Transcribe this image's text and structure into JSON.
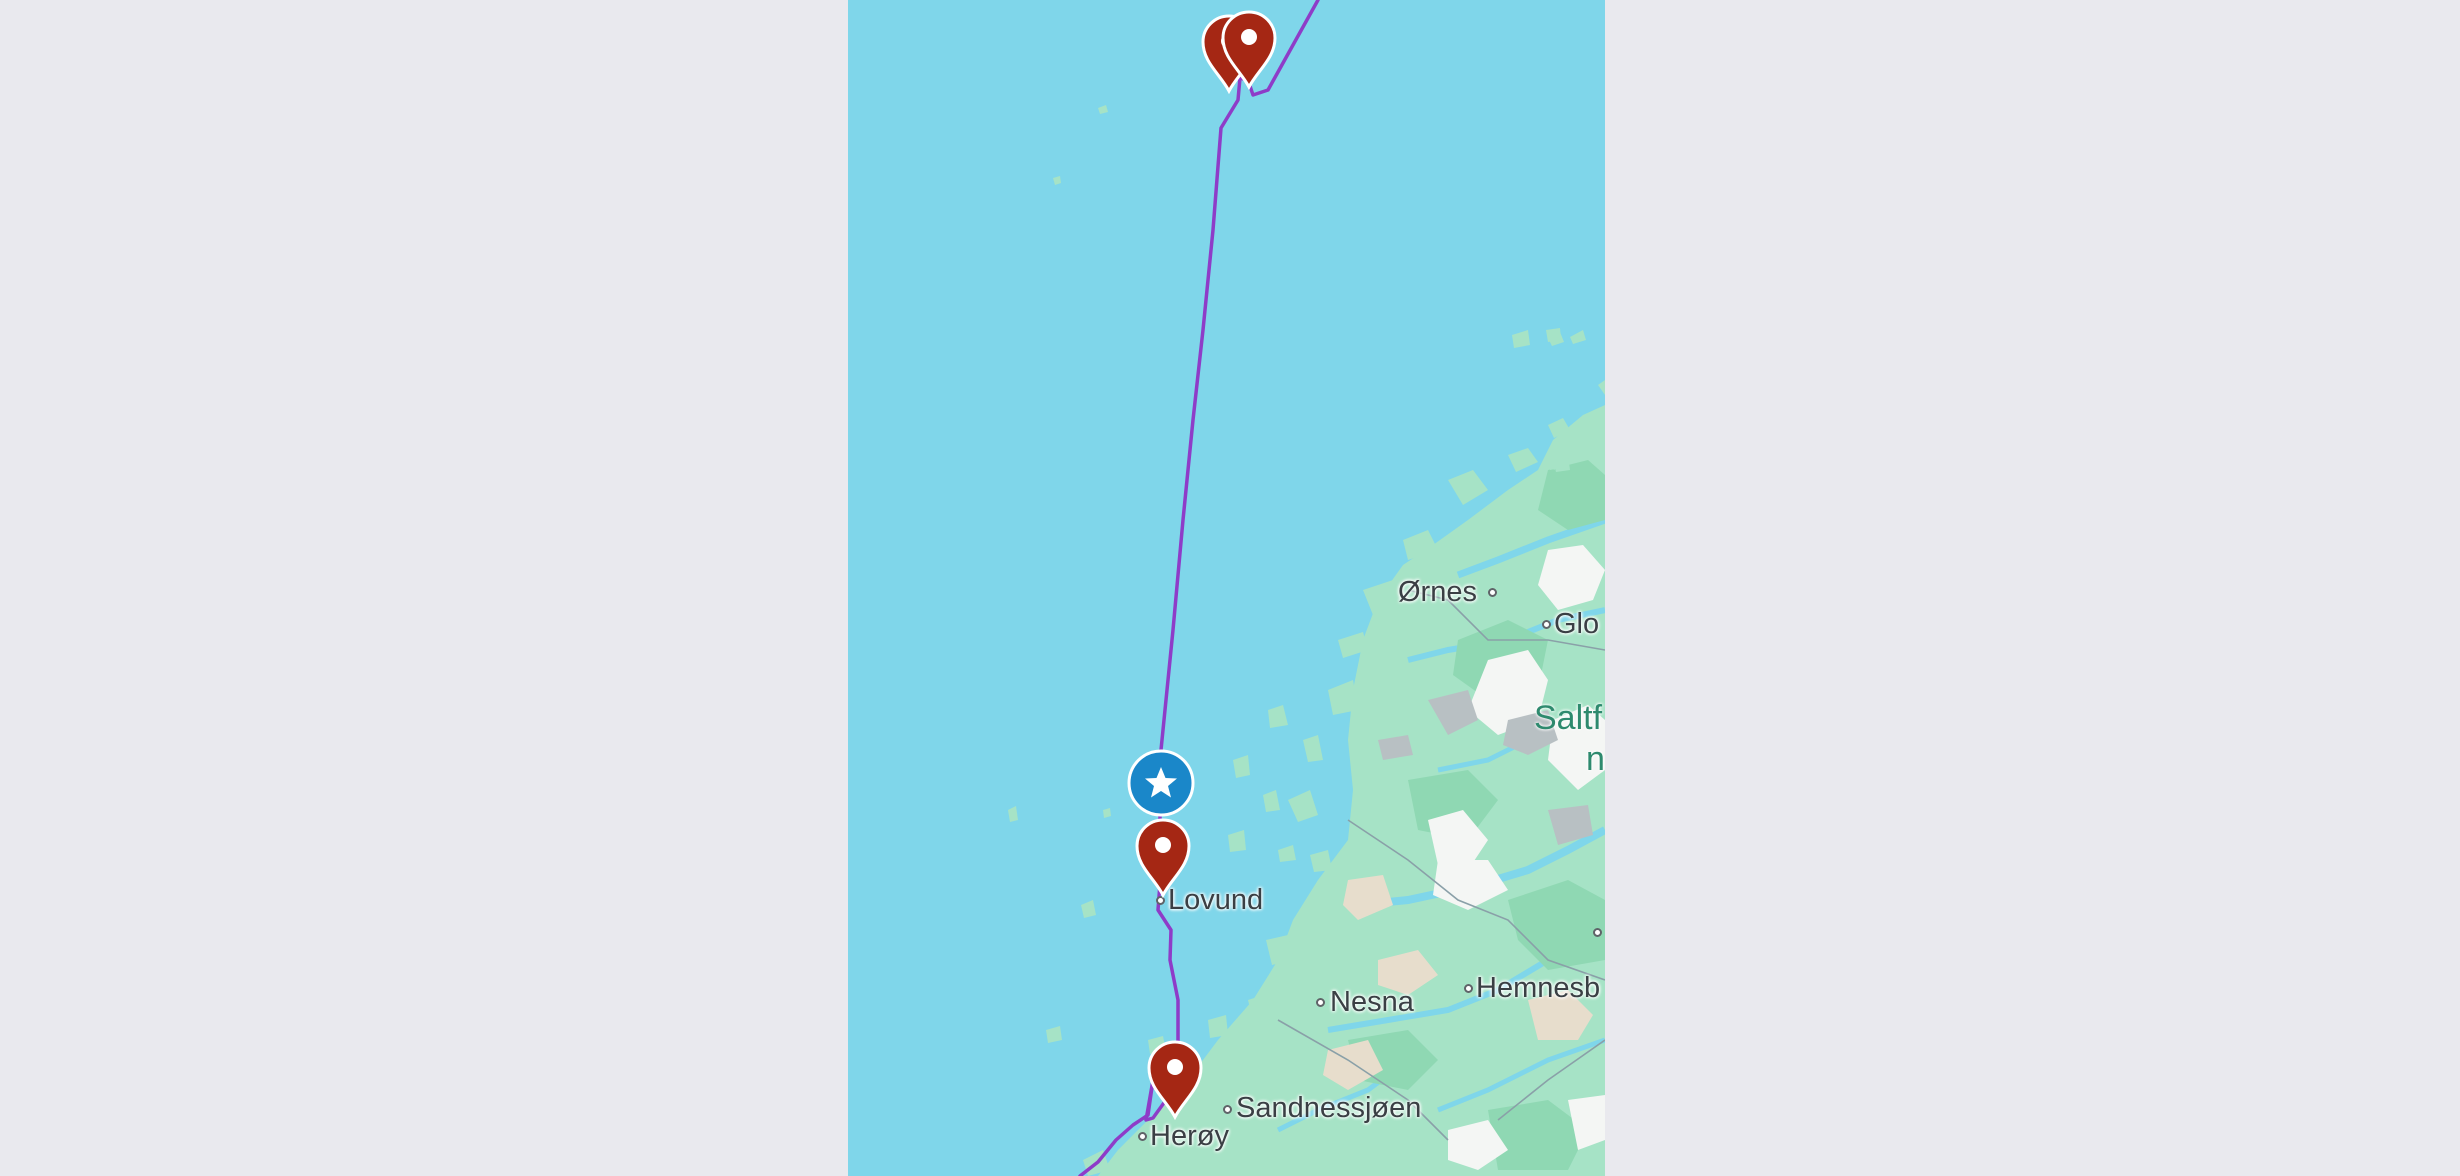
{
  "map": {
    "water_color": "#7fd6ea",
    "land_color": "#a6e3c6",
    "route_color": "#8e3cc8",
    "marker_color": "#a52714",
    "current_marker_color": "#1a87c9",
    "places": [
      {
        "name": "Ørnes"
      },
      {
        "name": "Glo"
      },
      {
        "name": "Lovund"
      },
      {
        "name": "Nesna"
      },
      {
        "name": "Hemnesb"
      },
      {
        "name": "Sandnessjøen"
      },
      {
        "name": "Herøy"
      }
    ],
    "park_label": {
      "line1": "Saltf",
      "line2": "n"
    },
    "markers": [
      {
        "icon": "map-pin-icon"
      },
      {
        "icon": "map-pin-icon"
      },
      {
        "icon": "map-pin-icon"
      },
      {
        "icon": "map-pin-icon"
      }
    ],
    "current_position": {
      "icon": "star-icon"
    }
  }
}
